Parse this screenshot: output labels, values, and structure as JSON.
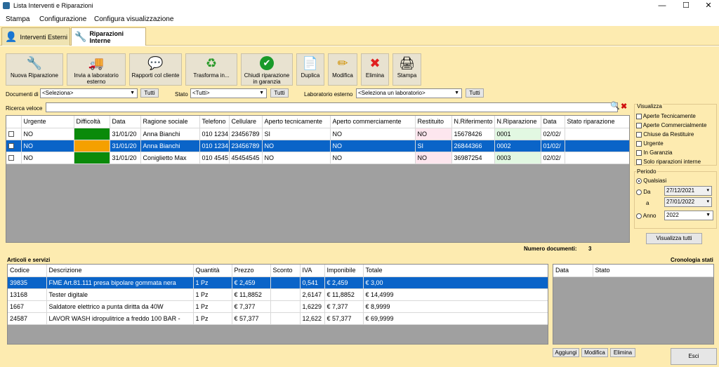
{
  "window": {
    "title": "Lista Interventi e Riparazioni",
    "min": "—",
    "max": "☐",
    "close": "✕"
  },
  "menu": [
    "Stampa",
    "Configurazione",
    "Configura visualizzazione"
  ],
  "tabs": [
    "Interventi Esterni",
    "Riparazioni Interne"
  ],
  "toolbar": [
    {
      "label": "Nuova Riparazione",
      "icon": "🔧"
    },
    {
      "label": "Invia a laboratorio esterno",
      "icon": "🚚"
    },
    {
      "label": "Rapporti col cliente",
      "icon": "💬"
    },
    {
      "label": "Trasforma in...",
      "icon": "♻"
    },
    {
      "label": "Chiudi riparazione in garanzia",
      "icon": "✔"
    },
    {
      "label": "Duplica",
      "icon": "📄"
    },
    {
      "label": "Modifica",
      "icon": "✏"
    },
    {
      "label": "Elimina",
      "icon": "✖"
    },
    {
      "label": "Stampa",
      "icon": "🖨"
    }
  ],
  "filters": {
    "documenti_label": "Documenti di",
    "documenti_value": "<Seleziona>",
    "tutti1": "Tutti",
    "stato_label": "Stato",
    "stato_value": "<Tutti>",
    "tutti2": "Tutti",
    "lab_label": "Laboratorio esterno",
    "lab_value": "<Seleziona un laboratorio>",
    "tutti3": "Tutti",
    "ricerca_label": "Ricerca veloce",
    "ricerca_value": ""
  },
  "main_columns": [
    "",
    "Urgente",
    "Difficoltà",
    "Data",
    "Ragione sociale",
    "Telefono",
    "Cellulare",
    "Aperto tecnicamente",
    "Aperto commerciamente",
    "Restituito",
    "N.Riferimento",
    "N.Riparazione",
    "Data",
    "Stato riparazione"
  ],
  "main_rows": [
    {
      "urgente": "NO",
      "diff_color": "#0a8a0a",
      "data": "31/01/20",
      "ragione": "Anna Bianchi",
      "tel": "010 1234",
      "cell": "23456789",
      "ap_tec": "SI",
      "ap_com": "NO",
      "rest": "NO",
      "rif": "15678426",
      "rip": "0001",
      "data2": "02/02/",
      "stato": ""
    },
    {
      "urgente": "NO",
      "diff_color": "#f5a000",
      "data": "31/01/20",
      "ragione": "Anna Bianchi",
      "tel": "010 1234",
      "cell": "23456789",
      "ap_tec": "NO",
      "ap_com": "NO",
      "rest": "SI",
      "rif": "26844366",
      "rip": "0002",
      "data2": "01/02/",
      "stato": ""
    },
    {
      "urgente": "NO",
      "diff_color": "#0a8a0a",
      "data": "31/01/20",
      "ragione": "Coniglietto Max",
      "tel": "010 4545",
      "cell": "45454545",
      "ap_tec": "NO",
      "ap_com": "NO",
      "rest": "NO",
      "rif": "36987254",
      "rip": "0003",
      "data2": "02/02/",
      "stato": ""
    }
  ],
  "visualizza": {
    "title": "Visualizza",
    "items": [
      "Aperte Tecnicamente",
      "Aperte Commercialmente",
      "Chiuse da Restituire",
      "Urgente",
      "In Garanzia",
      "Solo riparazioni interne"
    ]
  },
  "periodo": {
    "title": "Periodo",
    "qualsiasi": "Qualsiasi",
    "da": "Da",
    "da_value": "27/12/2021",
    "a": "a",
    "a_value": "27/01/2022",
    "anno": "Anno",
    "anno_value": "2022"
  },
  "visualizza_tutti": "Visualizza tutti",
  "numero_label": "Numero documenti:",
  "numero_value": "3",
  "articoli_title": "Articoli e servizi",
  "art_columns": [
    "Codice",
    "Descrizione",
    "Quantità",
    "Prezzo",
    "Sconto",
    "IVA",
    "Imponibile",
    "Totale"
  ],
  "art_rows": [
    {
      "codice": "39835",
      "desc": "FME Art.81.111 presa bipolare gommata nera",
      "qta": "1 Pz",
      "prezzo": "€ 2,459",
      "sconto": "",
      "iva": "0,541",
      "imp": "€ 2,459",
      "tot": "€ 3,00"
    },
    {
      "codice": "13168",
      "desc": "Tester digitale",
      "qta": "1 Pz",
      "prezzo": "€ 11,8852",
      "sconto": "",
      "iva": "2,6147",
      "imp": "€ 11,8852",
      "tot": "€ 14,4999"
    },
    {
      "codice": "1667",
      "desc": "Saldatore elettrico a punta diritta da 40W",
      "qta": "1 Pz",
      "prezzo": "€ 7,377",
      "sconto": "",
      "iva": "1,6229",
      "imp": "€ 7,377",
      "tot": "€ 8,9999"
    },
    {
      "codice": "24587",
      "desc": "LAVOR WASH idropulitrice a freddo 100 BAR -",
      "qta": "1 Pz",
      "prezzo": "€ 57,377",
      "sconto": "",
      "iva": "12,622",
      "imp": "€ 57,377",
      "tot": "€ 69,9999"
    }
  ],
  "cronologia_title": "Cronologia stati",
  "cron_columns": [
    "Data",
    "Stato"
  ],
  "bottom_buttons": {
    "aggiungi": "Aggiungi",
    "modifica": "Modifica",
    "elimina": "Elimina",
    "esci": "Esci"
  },
  "colors": {
    "panel": "#fdebb0",
    "selection": "#0a64c8",
    "green": "#0a8a0a",
    "orange": "#f5a000",
    "pink": "#fde6ee",
    "lightgreen": "#e2f8e2"
  }
}
